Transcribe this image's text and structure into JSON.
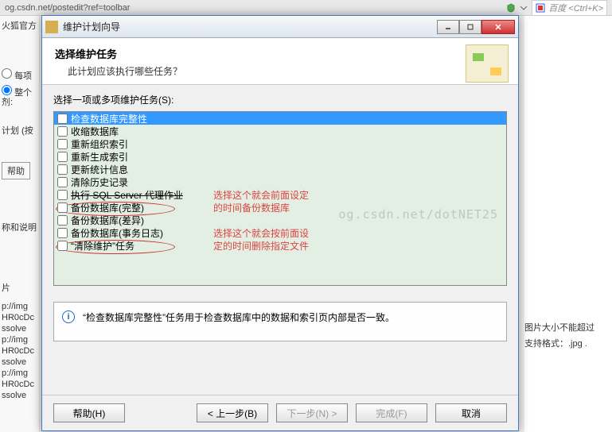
{
  "browser": {
    "url": "og.csdn.net/postedit?ref=toolbar",
    "search_placeholder": "百度 <Ctrl+K>"
  },
  "left_sidebar": {
    "tab": "火狐官方",
    "radio1": "每项",
    "radio2": "整个",
    "label_sep": "剂:",
    "label_plan": "计划 (按",
    "label_help": "帮助",
    "label_name": "称和说明",
    "label_pic": "片",
    "paths": [
      "p://img",
      "HR0cDc",
      "ssolve",
      "p://img",
      "HR0cDc",
      "ssolve",
      "p://img",
      "HR0cDc",
      "ssolve"
    ]
  },
  "right_sidebar": {
    "line1": "图片大小不能超过",
    "line2": "支持格式：.jpg ."
  },
  "dialog": {
    "title": "维护计划向导",
    "header_title": "选择维护任务",
    "header_sub": "此计划应该执行哪些任务？",
    "list_label": "选择一项或多项维护任务(S):",
    "items": [
      {
        "label": "检查数据库完整性",
        "selected": true
      },
      {
        "label": "收缩数据库"
      },
      {
        "label": "重新组织索引"
      },
      {
        "label": "重新生成索引"
      },
      {
        "label": "更新统计信息"
      },
      {
        "label": "清除历史记录"
      },
      {
        "label": "执行 SQL Server 代理作业",
        "strike": true,
        "annot": "选择这个就会前面设定"
      },
      {
        "label": "备份数据库(完整)",
        "annot": "的时间备份数据库"
      },
      {
        "label": "备份数据库(差异)"
      },
      {
        "label": "备份数据库(事务日志)",
        "annot": "选择这个就会按前面设"
      },
      {
        "label": "“清除维护”任务",
        "annot": "定的时间删除指定文件"
      }
    ],
    "watermark": "og.csdn.net/dotNET25",
    "info_text": "“检查数据库完整性”任务用于检查数据库中的数据和索引页内部是否一致。",
    "buttons": {
      "help": "帮助(H)",
      "back": "< 上一步(B)",
      "next": "下一步(N) >",
      "finish": "完成(F)",
      "cancel": "取消"
    }
  }
}
